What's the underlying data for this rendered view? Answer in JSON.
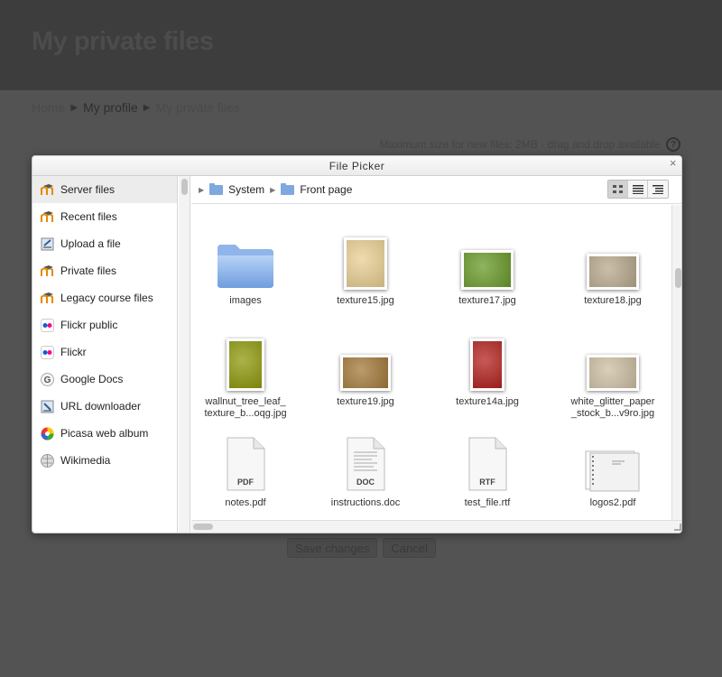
{
  "page": {
    "title": "My private files",
    "breadcrumb": [
      "Home",
      "My profile",
      "My private files"
    ],
    "max_size_text": "Maximum size for new files: 2MB - drag and drop available",
    "buttons": {
      "save": "Save changes",
      "cancel": "Cancel"
    }
  },
  "dialog": {
    "title": "File Picker",
    "close_glyph": "×",
    "repositories": [
      {
        "label": "Server files",
        "icon": "moodle-icon",
        "active": true
      },
      {
        "label": "Recent files",
        "icon": "moodle-icon"
      },
      {
        "label": "Upload a file",
        "icon": "upload-icon"
      },
      {
        "label": "Private files",
        "icon": "moodle-icon"
      },
      {
        "label": "Legacy course files",
        "icon": "moodle-icon"
      },
      {
        "label": "Flickr public",
        "icon": "flickr-icon"
      },
      {
        "label": "Flickr",
        "icon": "flickr-icon"
      },
      {
        "label": "Google Docs",
        "icon": "google-icon"
      },
      {
        "label": "URL downloader",
        "icon": "url-downloader-icon"
      },
      {
        "label": "Picasa web album",
        "icon": "picasa-icon"
      },
      {
        "label": "Wikimedia",
        "icon": "wikimedia-icon"
      }
    ],
    "path": [
      "System",
      "Front page"
    ],
    "view_modes": [
      "icons",
      "list",
      "tree"
    ],
    "files": [
      {
        "name": "images",
        "kind": "folder"
      },
      {
        "name": "texture15.jpg",
        "kind": "image",
        "color": "#e9cf93"
      },
      {
        "name": "texture17.jpg",
        "kind": "image",
        "color": "#6a9a2a"
      },
      {
        "name": "texture18.jpg",
        "kind": "image",
        "color": "#b8a98d"
      },
      {
        "name": "wallnut_tree_leaf_\ntexture_b...oqg.jpg",
        "kind": "image",
        "color": "#8f9a0c"
      },
      {
        "name": "texture19.jpg",
        "kind": "image",
        "color": "#a37a3a"
      },
      {
        "name": "texture14a.jpg",
        "kind": "image",
        "color": "#b3231f"
      },
      {
        "name": "white_glitter_paper\n_stock_b...v9ro.jpg",
        "kind": "image",
        "color": "#cdbfa3"
      },
      {
        "name": "notes.pdf",
        "kind": "doc",
        "label": "PDF"
      },
      {
        "name": "instructions.doc",
        "kind": "doc",
        "label": "DOC"
      },
      {
        "name": "test_file.rtf",
        "kind": "doc",
        "label": "RTF"
      },
      {
        "name": "logos2.pdf",
        "kind": "pdfpreview"
      }
    ]
  }
}
